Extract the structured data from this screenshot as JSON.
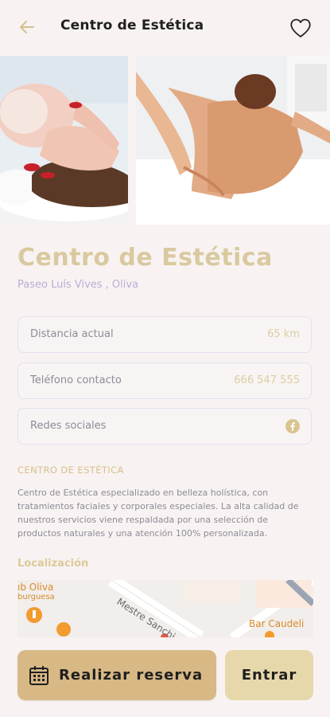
{
  "header": {
    "title": "Centro de Estética"
  },
  "center": {
    "name": "Centro de Estética",
    "address": "Paseo Luís Vives , Oliva"
  },
  "info": [
    {
      "label": "Distancia actual",
      "value": "65 km"
    },
    {
      "label": "Teléfono contacto",
      "value": "666 547 555"
    },
    {
      "label": "Redes sociales",
      "icon": "facebook-icon"
    }
  ],
  "about": {
    "heading": "CENTRO DE ESTÉTICA",
    "text": "Centro de Estética  especializado  en belleza holística, con tratamientos faciales y corporales especiales. La alta calidad de nuestros servicios viene respaldada por una selección de productos naturales y una atención 100% personalizada."
  },
  "location": {
    "heading": "Localización",
    "map_labels": {
      "place_1": "ıb Oliva",
      "place_1_sub": "burguesa",
      "street": "Mestre Sanchi",
      "place_2": "Bar Caudeli"
    }
  },
  "actions": {
    "reserve_label": "Realizar reserva",
    "enter_label": "Entrar"
  },
  "colors": {
    "accent_gold": "#d8b885",
    "accent_light": "#e6d8ab",
    "lavender": "#b6aed6",
    "background": "#f8f3f2"
  }
}
